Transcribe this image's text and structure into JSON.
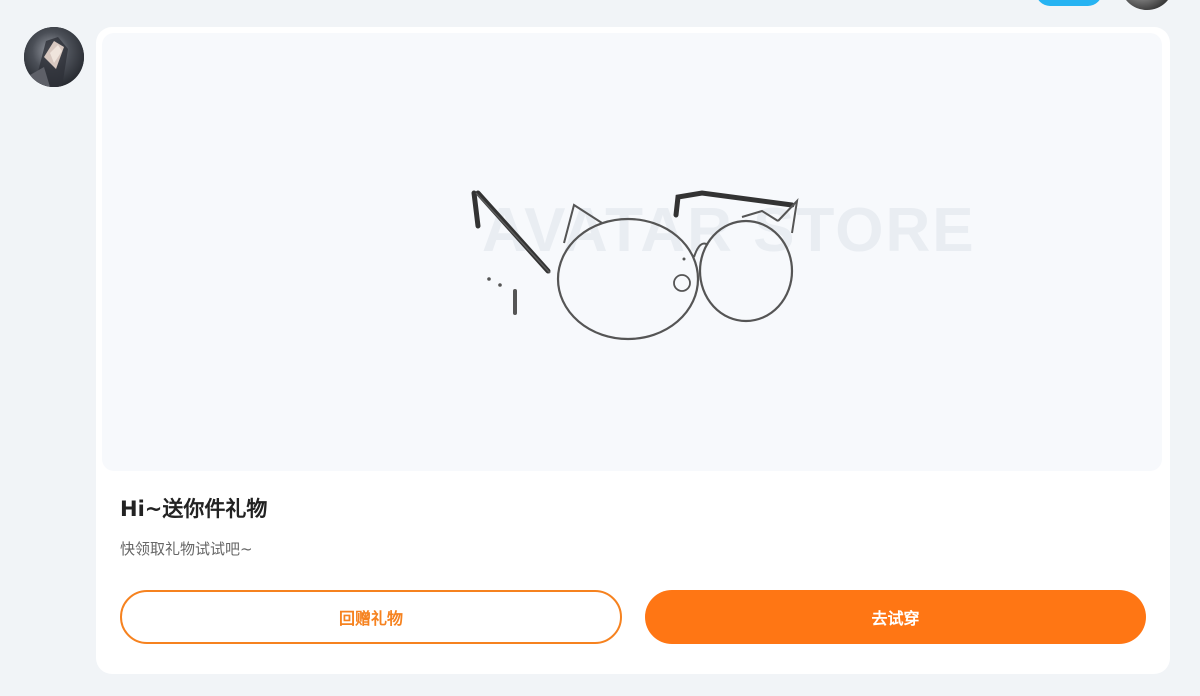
{
  "message": {
    "sender_avatar": "avatar-photo",
    "gift_image": "cat-ear-glasses-illustration",
    "watermark_text": "AVATAR STORE",
    "title": "Hi~送你件礼物",
    "subtitle": "快领取礼物试试吧~",
    "buttons": {
      "return_gift": "回赠礼物",
      "try_on": "去试穿"
    }
  },
  "colors": {
    "accent": "#ff7614",
    "outline": "#f6821f",
    "page_bg": "#f1f4f7",
    "card_bg": "#ffffff",
    "top_pill": "#26b3f2"
  }
}
